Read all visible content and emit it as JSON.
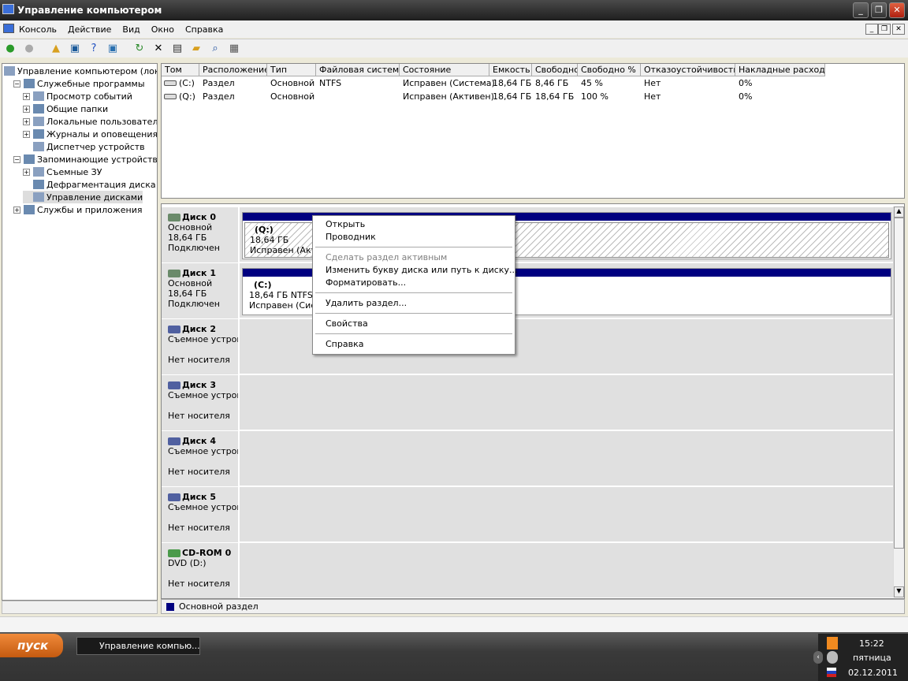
{
  "window": {
    "title": "Управление компьютером"
  },
  "menu": [
    "Консоль",
    "Действие",
    "Вид",
    "Окно",
    "Справка"
  ],
  "toolbar": [
    "back-icon",
    "forward-icon",
    "up-folder-icon",
    "show-hide-tree-icon",
    "help-icon",
    "new-window-icon",
    "refresh-icon",
    "delete-icon",
    "properties-icon",
    "open-icon",
    "search-icon",
    "settings-icon"
  ],
  "tree": [
    {
      "label": "Управление компьютером (локальным)",
      "level": 0
    },
    {
      "label": "Служебные программы",
      "level": 1
    },
    {
      "label": "Просмотр событий",
      "level": 2
    },
    {
      "label": "Общие папки",
      "level": 2
    },
    {
      "label": "Локальные пользователи",
      "level": 2
    },
    {
      "label": "Журналы и оповещения производительности",
      "level": 2
    },
    {
      "label": "Диспетчер устройств",
      "level": 2
    },
    {
      "label": "Запоминающие устройства",
      "level": 1
    },
    {
      "label": "Съемные ЗУ",
      "level": 2
    },
    {
      "label": "Дефрагментация диска",
      "level": 2
    },
    {
      "label": "Управление дисками",
      "level": 2
    },
    {
      "label": "Службы и приложения",
      "level": 1
    }
  ],
  "columns": [
    "Том",
    "Расположение",
    "Тип",
    "Файловая система",
    "Состояние",
    "Емкость",
    "Свободно",
    "Свободно %",
    "Отказоустойчивость",
    "Накладные расходы"
  ],
  "volumes": [
    [
      "(C:)",
      "Раздел",
      "Основной",
      "NTFS",
      "Исправен (Система)",
      "18,64 ГБ",
      "8,46 ГБ",
      "45 %",
      "Нет",
      "0%"
    ],
    [
      "(Q:)",
      "Раздел",
      "Основной",
      "",
      "Исправен (Активен)",
      "18,64 ГБ",
      "18,64 ГБ",
      "100 %",
      "Нет",
      "0%"
    ]
  ],
  "disks": [
    {
      "name": "Диск 0",
      "l1": "Основной",
      "l2": "18,64 ГБ",
      "l3": "Подключен",
      "part": {
        "label": "(Q:)",
        "size": "18,64 ГБ",
        "status": "Исправен (Активен)"
      }
    },
    {
      "name": "Диск 1",
      "l1": "Основной",
      "l2": "18,64 ГБ",
      "l3": "Подключен",
      "part": {
        "label": "(C:)",
        "size": "18,64 ГБ NTFS",
        "status": "Исправен (Система)"
      }
    },
    {
      "name": "Диск 2",
      "l1": "Съемное устройство",
      "l2": "",
      "l3": "Нет носителя"
    },
    {
      "name": "Диск 3",
      "l1": "Съемное устройство",
      "l2": "",
      "l3": "Нет носителя"
    },
    {
      "name": "Диск 4",
      "l1": "Съемное устройство",
      "l2": "",
      "l3": "Нет носителя"
    },
    {
      "name": "Диск 5",
      "l1": "Съемное устройство",
      "l2": "",
      "l3": "Нет носителя"
    },
    {
      "name": "CD-ROM 0",
      "l1": "DVD (D:)",
      "l2": "",
      "l3": "Нет носителя"
    }
  ],
  "legend": {
    "label": "Основной раздел",
    "color": "#000080"
  },
  "context_menu": [
    {
      "label": "Открыть",
      "enabled": true
    },
    {
      "label": "Проводник",
      "enabled": true
    },
    {
      "sep": true
    },
    {
      "label": "Сделать раздел активным",
      "enabled": false
    },
    {
      "label": "Изменить букву диска или путь к диску...",
      "enabled": true
    },
    {
      "label": "Форматировать...",
      "enabled": true
    },
    {
      "sep": true
    },
    {
      "label": "Удалить раздел...",
      "enabled": true
    },
    {
      "sep": true
    },
    {
      "label": "Свойства",
      "enabled": true
    },
    {
      "sep": true
    },
    {
      "label": "Справка",
      "enabled": true
    }
  ],
  "taskbar": {
    "start": "пуск",
    "task": "Управление компью...",
    "time": "15:22",
    "day": "пятница",
    "date": "02.12.2011"
  }
}
